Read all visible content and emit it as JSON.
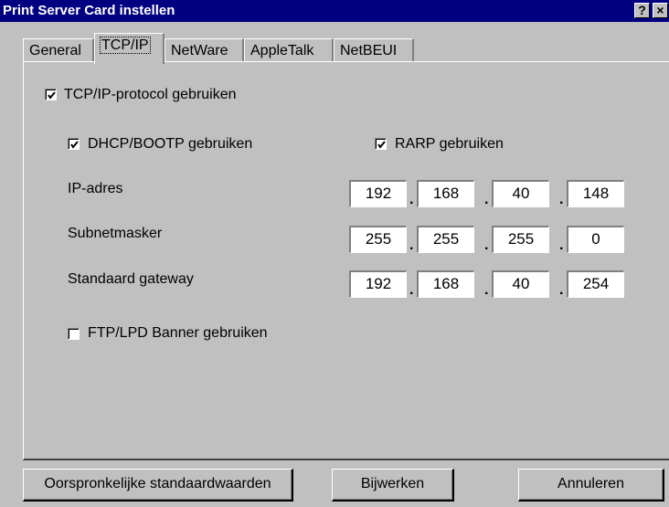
{
  "window": {
    "title": "Print Server Card instellen",
    "help_label": "?",
    "close_label": "×"
  },
  "tabs": [
    {
      "label": "General"
    },
    {
      "label": "TCP/IP",
      "active": true
    },
    {
      "label": "NetWare"
    },
    {
      "label": "AppleTalk"
    },
    {
      "label": "NetBEUI"
    }
  ],
  "tcpip": {
    "use_tcpip": {
      "label": "TCP/IP-protocol gebruiken",
      "checked": true
    },
    "use_dhcp": {
      "label": "DHCP/BOOTP gebruiken",
      "checked": true
    },
    "use_rarp": {
      "label": "RARP gebruiken",
      "checked": true
    },
    "ip_address": {
      "label": "IP-adres",
      "octets": [
        "192",
        "168",
        "40",
        "148"
      ]
    },
    "subnet_mask": {
      "label": "Subnetmasker",
      "octets": [
        "255",
        "255",
        "255",
        "0"
      ]
    },
    "gateway": {
      "label": "Standaard gateway",
      "octets": [
        "192",
        "168",
        "40",
        "254"
      ]
    },
    "ftp_banner": {
      "label": "FTP/LPD Banner gebruiken",
      "checked": false
    },
    "octet_separator": "."
  },
  "buttons": {
    "defaults": "Oorspronkelijke standaardwaarden",
    "update": "Bijwerken",
    "cancel": "Annuleren"
  }
}
